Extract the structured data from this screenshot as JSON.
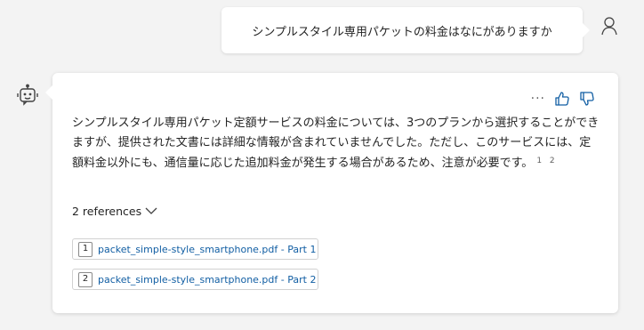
{
  "user_message": {
    "text": "シンプルスタイル専用パケットの料金はなにがありますか"
  },
  "bot_message": {
    "text": "シンプルスタイル専用パケット定額サービスの料金については、3つのプランから選択することができますが、提供された文書には詳細な情報が含まれていませんでした。ただし、このサービスには、定額料金以外にも、通信量に応じた追加料金が発生する場合があるため、注意が必要です。",
    "citations": "1 2",
    "more_icon": "more-options-icon",
    "like_icon": "thumbs-up-icon",
    "dislike_icon": "thumbs-down-icon"
  },
  "references": {
    "toggle_label": "2 references",
    "items": [
      {
        "num": "1",
        "label": "packet_simple-style_smartphone.pdf - Part 1"
      },
      {
        "num": "2",
        "label": "packet_simple-style_smartphone.pdf - Part 2"
      }
    ]
  },
  "colors": {
    "background": "#f3f3f3",
    "card": "#ffffff",
    "link": "#115ea3",
    "text": "#242424"
  }
}
